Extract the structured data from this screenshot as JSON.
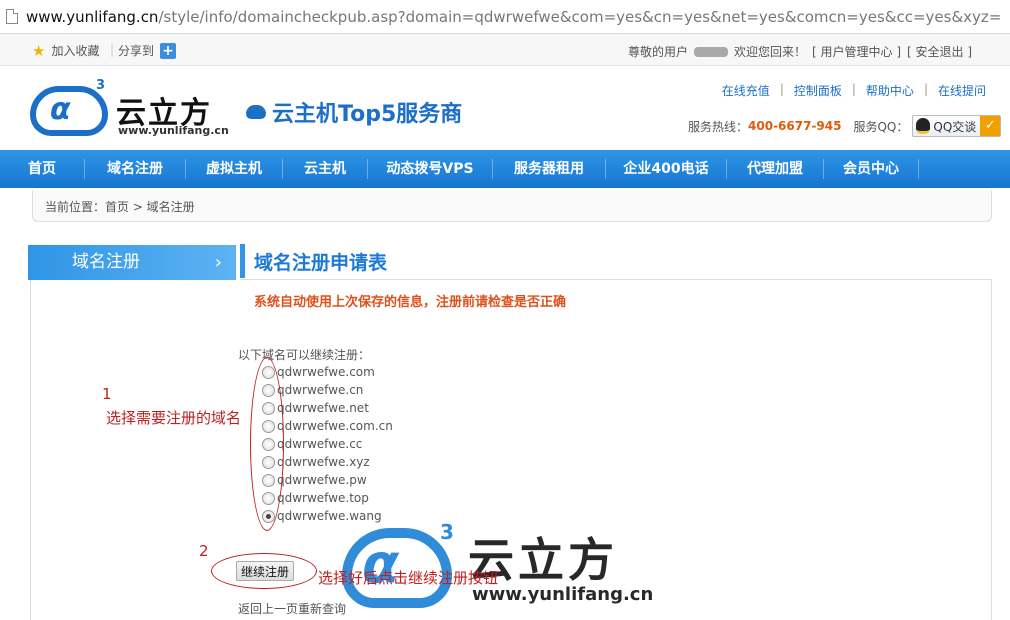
{
  "browser": {
    "url_domain": "www.yunlifang.cn",
    "url_path": "/style/info/domaincheckpub.asp?domain=qdwrwefwe&com=yes&cn=yes&net=yes&comcn=yes&cc=yes&xyz="
  },
  "topbar": {
    "favorite_label": "加入收藏",
    "share_label": "分享到",
    "greeting_prefix": "尊敬的用户",
    "greeting_suffix": "欢迎您回来！",
    "user_center": "[ 用户管理中心 ]",
    "logout": "[ 安全退出 ]"
  },
  "header": {
    "brand": "云立方",
    "brand_domain": "www.yunlifang.cn",
    "brand_superscript": "3",
    "slogan": "云主机Top5服务商",
    "toplinks": [
      "在线充值",
      "控制面板",
      "帮助中心",
      "在线提问"
    ],
    "link_separator": "|",
    "hotline_label": "服务热线：",
    "hotline_number": "400-6677-945",
    "qq_label": "服务QQ：",
    "qq_button": "QQ交谈",
    "accent_color": "#1c6fc6",
    "hotline_color": "#e05a0e"
  },
  "nav": {
    "items": [
      "首页",
      "域名注册",
      "虚拟主机",
      "云主机",
      "动态拨号VPS",
      "服务器租用",
      "企业400电话",
      "代理加盟",
      "会员中心"
    ]
  },
  "breadcrumb": {
    "text": "当前位置：首页 > 域名注册"
  },
  "sidebar": {
    "title": "域名注册"
  },
  "form": {
    "title": "域名注册申请表",
    "notice": "系统自动使用上次保存的信息，注册前请检查是否正确",
    "available_label": "以下域名可以继续注册：",
    "domains": [
      {
        "name": "qdwrwefwe.com",
        "checked": false
      },
      {
        "name": "qdwrwefwe.cn",
        "checked": false
      },
      {
        "name": "qdwrwefwe.net",
        "checked": false
      },
      {
        "name": "qdwrwefwe.com.cn",
        "checked": false
      },
      {
        "name": "qdwrwefwe.cc",
        "checked": false
      },
      {
        "name": "qdwrwefwe.xyz",
        "checked": false
      },
      {
        "name": "qdwrwefwe.pw",
        "checked": false
      },
      {
        "name": "qdwrwefwe.top",
        "checked": false
      },
      {
        "name": "qdwrwefwe.wang",
        "checked": true
      }
    ],
    "submit_label": "继续注册",
    "back_link": "返回上一页重新查询"
  },
  "annotations": {
    "step1_number": "1",
    "step1_text": "选择需要注册的域名",
    "step2_number": "2",
    "step2_text": "选择好后点击继续注册按钮",
    "color": "#c02020"
  },
  "watermark": {
    "brand": "云立方",
    "domain": "www.yunlifang.cn",
    "superscript": "3"
  }
}
